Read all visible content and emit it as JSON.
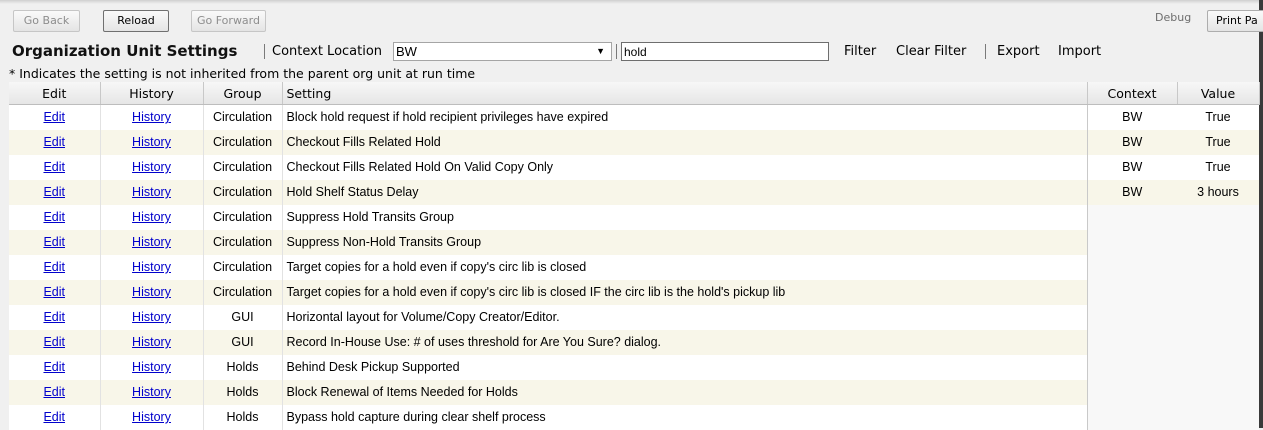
{
  "toolbar": {
    "back_label": "Go Back",
    "reload_label": "Reload",
    "forward_label": "Go Forward",
    "debug_label": "Debug",
    "print_label": "Print Pa"
  },
  "header": {
    "title": "Organization Unit Settings",
    "context_location_label": "Context Location",
    "context_location_value": "BW",
    "search_value": "hold",
    "filter_label": "Filter",
    "clear_filter_label": "Clear Filter",
    "export_label": "Export",
    "import_label": "Import"
  },
  "note": "* Indicates the setting is not inherited from the parent org unit at run time",
  "table": {
    "headers": [
      "Edit",
      "History",
      "Group",
      "Setting",
      "Context",
      "Value"
    ],
    "rows": [
      {
        "edit": "Edit",
        "history": "History",
        "group": "Circulation",
        "setting": "Block hold request if hold recipient privileges have expired",
        "context": "BW",
        "value": "True"
      },
      {
        "edit": "Edit",
        "history": "History",
        "group": "Circulation",
        "setting": "Checkout Fills Related Hold",
        "context": "BW",
        "value": "True"
      },
      {
        "edit": "Edit",
        "history": "History",
        "group": "Circulation",
        "setting": "Checkout Fills Related Hold On Valid Copy Only",
        "context": "BW",
        "value": "True"
      },
      {
        "edit": "Edit",
        "history": "History",
        "group": "Circulation",
        "setting": "Hold Shelf Status Delay",
        "context": "BW",
        "value": "3 hours"
      },
      {
        "edit": "Edit",
        "history": "History",
        "group": "Circulation",
        "setting": "Suppress Hold Transits Group",
        "context": "",
        "value": ""
      },
      {
        "edit": "Edit",
        "history": "History",
        "group": "Circulation",
        "setting": "Suppress Non-Hold Transits Group",
        "context": "",
        "value": ""
      },
      {
        "edit": "Edit",
        "history": "History",
        "group": "Circulation",
        "setting": "Target copies for a hold even if copy's circ lib is closed",
        "context": "",
        "value": ""
      },
      {
        "edit": "Edit",
        "history": "History",
        "group": "Circulation",
        "setting": "Target copies for a hold even if copy's circ lib is closed IF the circ lib is the hold's pickup lib",
        "context": "",
        "value": ""
      },
      {
        "edit": "Edit",
        "history": "History",
        "group": "GUI",
        "setting": "Horizontal layout for Volume/Copy Creator/Editor.",
        "context": "",
        "value": ""
      },
      {
        "edit": "Edit",
        "history": "History",
        "group": "GUI",
        "setting": "Record In-House Use: # of uses threshold for Are You Sure? dialog.",
        "context": "",
        "value": ""
      },
      {
        "edit": "Edit",
        "history": "History",
        "group": "Holds",
        "setting": "Behind Desk Pickup Supported",
        "context": "",
        "value": ""
      },
      {
        "edit": "Edit",
        "history": "History",
        "group": "Holds",
        "setting": "Block Renewal of Items Needed for Holds",
        "context": "",
        "value": ""
      },
      {
        "edit": "Edit",
        "history": "History",
        "group": "Holds",
        "setting": "Bypass hold capture during clear shelf process",
        "context": "",
        "value": ""
      }
    ]
  }
}
